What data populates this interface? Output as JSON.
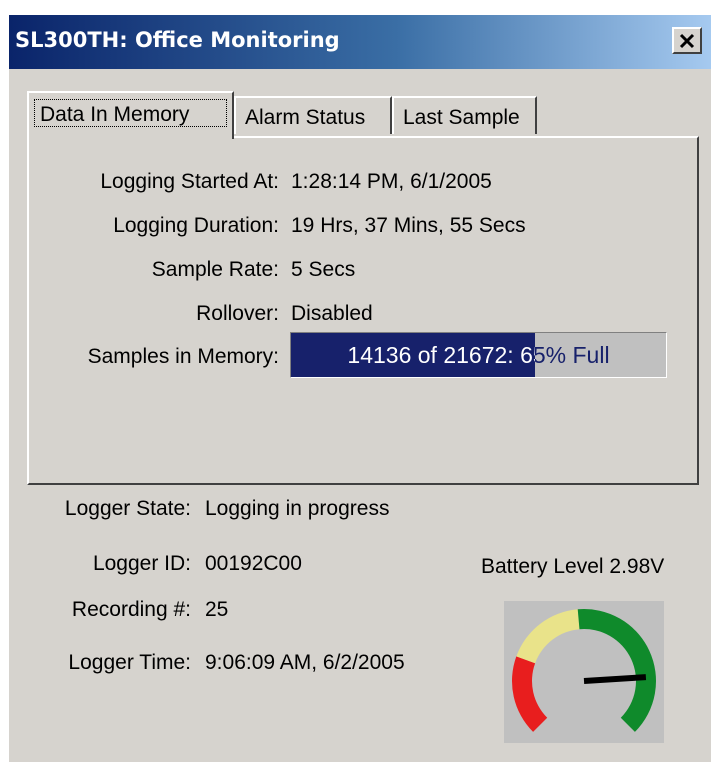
{
  "window": {
    "title": "SL300TH: Office Monitoring",
    "close_glyph": "✕"
  },
  "tabs": [
    {
      "label": "Data In Memory",
      "active": true
    },
    {
      "label": "Alarm Status",
      "active": false
    },
    {
      "label": "Last Sample",
      "active": false
    }
  ],
  "memory": {
    "logging_started_label": "Logging Started At:",
    "logging_started_value": "1:28:14 PM, 6/1/2005",
    "logging_duration_label": "Logging Duration:",
    "logging_duration_value": "19 Hrs, 37 Mins, 55 Secs",
    "sample_rate_label": "Sample Rate:",
    "sample_rate_value": "5 Secs",
    "rollover_label": "Rollover:",
    "rollover_value": "Disabled",
    "samples_label": "Samples in Memory:",
    "samples_text": "14136 of 21672: 65% Full",
    "samples_fraction": 0.65
  },
  "logger": {
    "state_label": "Logger State:",
    "state_value": "Logging in progress",
    "id_label": "Logger ID:",
    "id_value": "00192C00",
    "recording_label": "Recording #:",
    "recording_value": "25",
    "time_label": "Logger Time:",
    "time_value": "9:06:09 AM, 6/2/2005"
  },
  "battery": {
    "label": "Battery Level 2.98V",
    "needle_fraction": 0.82,
    "colors": {
      "low": "#e81e1e",
      "mid": "#e9e38a",
      "high": "#0f8a2b",
      "needle": "#000000",
      "background": "#c0c0c0"
    }
  }
}
